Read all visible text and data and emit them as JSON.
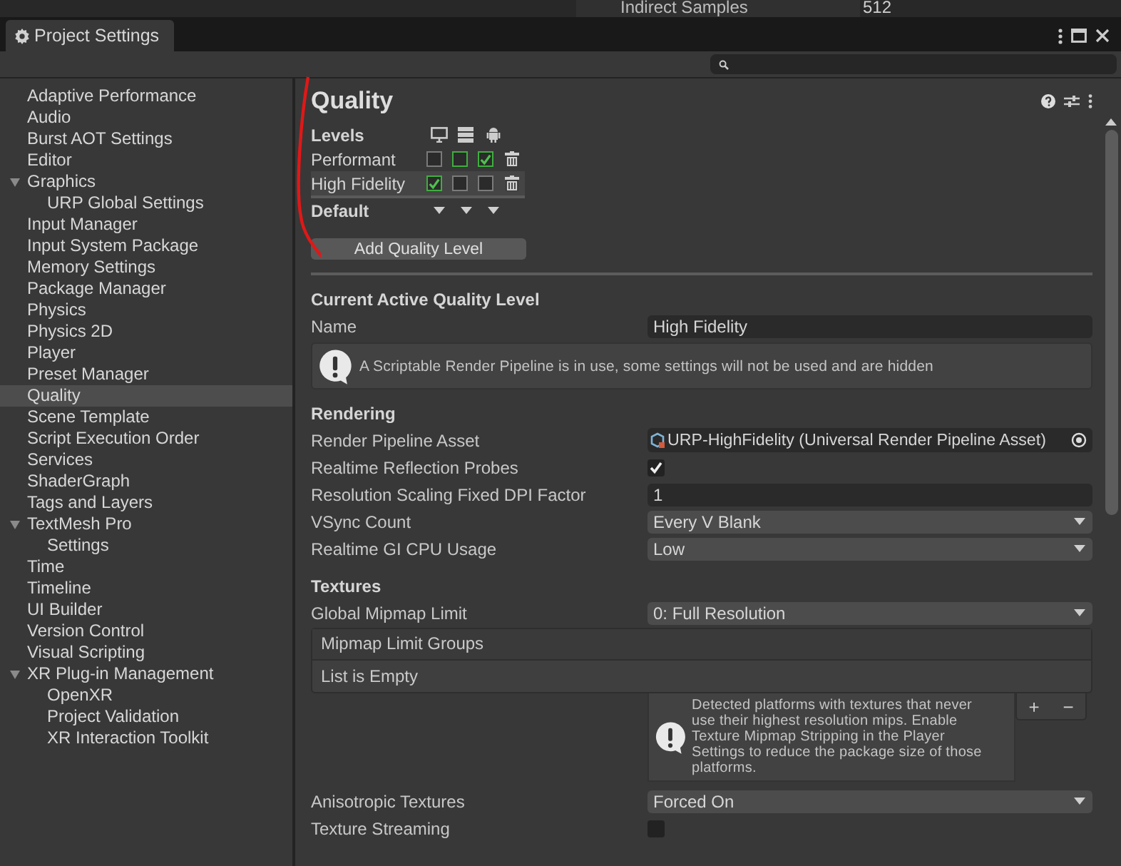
{
  "background_panel": {
    "label": "Indirect Samples",
    "value": "512"
  },
  "window": {
    "title": "Project Settings"
  },
  "sidebar": {
    "items": [
      {
        "label": "Adaptive Performance",
        "selected": false
      },
      {
        "label": "Audio",
        "selected": false
      },
      {
        "label": "Burst AOT Settings",
        "selected": false
      },
      {
        "label": "Editor",
        "selected": false
      },
      {
        "label": "Graphics",
        "selected": false,
        "expanded": true,
        "children": [
          {
            "label": "URP Global Settings",
            "selected": false
          }
        ]
      },
      {
        "label": "Input Manager",
        "selected": false
      },
      {
        "label": "Input System Package",
        "selected": false
      },
      {
        "label": "Memory Settings",
        "selected": false
      },
      {
        "label": "Package Manager",
        "selected": false
      },
      {
        "label": "Physics",
        "selected": false
      },
      {
        "label": "Physics 2D",
        "selected": false
      },
      {
        "label": "Player",
        "selected": false
      },
      {
        "label": "Preset Manager",
        "selected": false
      },
      {
        "label": "Quality",
        "selected": true
      },
      {
        "label": "Scene Template",
        "selected": false
      },
      {
        "label": "Script Execution Order",
        "selected": false
      },
      {
        "label": "Services",
        "selected": false
      },
      {
        "label": "ShaderGraph",
        "selected": false
      },
      {
        "label": "Tags and Layers",
        "selected": false
      },
      {
        "label": "TextMesh Pro",
        "selected": false,
        "expanded": true,
        "children": [
          {
            "label": "Settings",
            "selected": false
          }
        ]
      },
      {
        "label": "Time",
        "selected": false
      },
      {
        "label": "Timeline",
        "selected": false
      },
      {
        "label": "UI Builder",
        "selected": false
      },
      {
        "label": "Version Control",
        "selected": false
      },
      {
        "label": "Visual Scripting",
        "selected": false
      },
      {
        "label": "XR Plug-in Management",
        "selected": false,
        "expanded": true,
        "children": [
          {
            "label": "OpenXR",
            "selected": false
          },
          {
            "label": "Project Validation",
            "selected": false
          },
          {
            "label": "XR Interaction Toolkit",
            "selected": false
          }
        ]
      }
    ]
  },
  "content": {
    "title": "Quality",
    "levels": {
      "label": "Levels",
      "rows": [
        {
          "name": "Performant",
          "selected": false,
          "platforms": [
            {
              "checked": false,
              "default": false
            },
            {
              "checked": false,
              "default": true
            },
            {
              "checked": true,
              "default": true
            }
          ]
        },
        {
          "name": "High Fidelity",
          "selected": true,
          "platforms": [
            {
              "checked": true,
              "default": true
            },
            {
              "checked": false,
              "default": false
            },
            {
              "checked": false,
              "default": false
            }
          ]
        }
      ],
      "default_label": "Default",
      "add_button": "Add Quality Level"
    },
    "sections": [
      {
        "heading": "Current Active Quality Level",
        "rows": [
          {
            "kind": "text",
            "label": "Name",
            "value": "High Fidelity"
          },
          {
            "kind": "help",
            "text": "A Scriptable Render Pipeline is in use, some settings will not be used and are hidden"
          }
        ]
      },
      {
        "heading": "Rendering",
        "rows": [
          {
            "kind": "asset",
            "label": "Render Pipeline Asset",
            "value": "URP-HighFidelity (Universal Render Pipeline Asset)"
          },
          {
            "kind": "check",
            "label": "Realtime Reflection Probes",
            "checked": true
          },
          {
            "kind": "text",
            "label": "Resolution Scaling Fixed DPI Factor",
            "value": "1"
          },
          {
            "kind": "dropdown",
            "label": "VSync Count",
            "value": "Every V Blank"
          },
          {
            "kind": "dropdown",
            "label": "Realtime GI CPU Usage",
            "value": "Low"
          }
        ]
      },
      {
        "heading": "Textures",
        "rows": [
          {
            "kind": "dropdown",
            "label": "Global Mipmap Limit",
            "value": "0: Full Resolution"
          },
          {
            "kind": "list",
            "label": "Mipmap Limit Groups",
            "empty_text": "List is Empty",
            "add": "+",
            "remove": "−"
          },
          {
            "kind": "side_help",
            "text": "Detected platforms with textures that never use their highest resolution mips. Enable Texture Mipmap Stripping in the Player Settings to reduce the package size of those platforms."
          },
          {
            "kind": "dropdown",
            "label": "Anisotropic Textures",
            "value": "Forced On"
          },
          {
            "kind": "check",
            "label": "Texture Streaming",
            "checked": false
          }
        ]
      }
    ]
  }
}
